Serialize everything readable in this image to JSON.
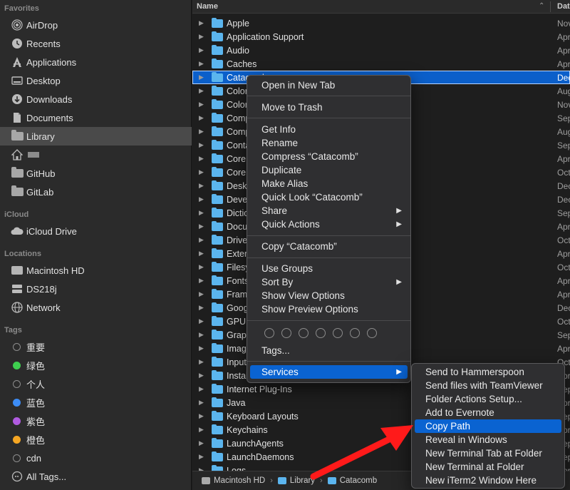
{
  "sidebar": {
    "favorites_header": "Favorites",
    "favorites": [
      {
        "label": "AirDrop",
        "icon": "airdrop-icon"
      },
      {
        "label": "Recents",
        "icon": "clock-icon"
      },
      {
        "label": "Applications",
        "icon": "applications-icon"
      },
      {
        "label": "Desktop",
        "icon": "desktop-icon"
      },
      {
        "label": "Downloads",
        "icon": "download-icon"
      },
      {
        "label": "Documents",
        "icon": "document-icon"
      },
      {
        "label": "Library",
        "icon": "folder-icon"
      },
      {
        "label": "",
        "icon": "home-icon"
      },
      {
        "label": "GitHub",
        "icon": "folder-icon"
      },
      {
        "label": "GitLab",
        "icon": "folder-icon"
      }
    ],
    "icloud_header": "iCloud",
    "icloud": [
      {
        "label": "iCloud Drive",
        "icon": "cloud-icon"
      }
    ],
    "locations_header": "Locations",
    "locations": [
      {
        "label": "Macintosh HD",
        "icon": "disk-icon"
      },
      {
        "label": "DS218j",
        "icon": "server-icon"
      },
      {
        "label": "Network",
        "icon": "globe-icon"
      }
    ],
    "tags_header": "Tags",
    "tags": [
      {
        "label": "重要",
        "color": ""
      },
      {
        "label": "绿色",
        "color": "#3ecf4f"
      },
      {
        "label": "个人",
        "color": ""
      },
      {
        "label": "蓝色",
        "color": "#3c8cf5"
      },
      {
        "label": "紫色",
        "color": "#b05be0"
      },
      {
        "label": "橙色",
        "color": "#f5a623"
      },
      {
        "label": "cdn",
        "color": ""
      },
      {
        "label": "All Tags...",
        "color": "",
        "icon": "tags-icon"
      }
    ]
  },
  "list": {
    "name_header": "Name",
    "date_header": "Dat",
    "rows": [
      {
        "name": "Apple",
        "date": "Nov"
      },
      {
        "name": "Application Support",
        "date": "Apr"
      },
      {
        "name": "Audio",
        "date": "Apr"
      },
      {
        "name": "Caches",
        "date": "Apr"
      },
      {
        "name": "Catacomb",
        "date": "Dec"
      },
      {
        "name": "Colors",
        "date": "Aug"
      },
      {
        "name": "ColorSync",
        "date": "Nov"
      },
      {
        "name": "Compositions",
        "date": "Sep"
      },
      {
        "name": "Components",
        "date": "Aug"
      },
      {
        "name": "Containers",
        "date": "Sep"
      },
      {
        "name": "CoreData",
        "date": "Apr"
      },
      {
        "name": "CoreLocation",
        "date": "Oct"
      },
      {
        "name": "Desktop Pictures",
        "date": "Dec"
      },
      {
        "name": "Developer",
        "date": "Dec"
      },
      {
        "name": "Dictionaries",
        "date": "Sep"
      },
      {
        "name": "Documentation",
        "date": "Apr"
      },
      {
        "name": "Drivers",
        "date": "Oct"
      },
      {
        "name": "Extensions",
        "date": "Apr"
      },
      {
        "name": "Filesystems",
        "date": "Oct"
      },
      {
        "name": "Fonts",
        "date": "Apr"
      },
      {
        "name": "Frameworks",
        "date": "Apr"
      },
      {
        "name": "Google",
        "date": "Dec"
      },
      {
        "name": "GPUBundles",
        "date": "Oct"
      },
      {
        "name": "Graphics",
        "date": "Sep"
      },
      {
        "name": "Image Capture",
        "date": "Apr"
      },
      {
        "name": "Input Methods",
        "date": "Oct"
      },
      {
        "name": "Installer",
        "date": "Apr"
      },
      {
        "name": "Internet Plug-Ins",
        "date": "Sep"
      },
      {
        "name": "Java",
        "date": "Apr"
      },
      {
        "name": "Keyboard Layouts",
        "date": "Sep"
      },
      {
        "name": "Keychains",
        "date": "Apr"
      },
      {
        "name": "LaunchAgents",
        "date": "Sep"
      },
      {
        "name": "LaunchDaemons",
        "date": "Sep"
      },
      {
        "name": "Logs",
        "date": "Apr"
      }
    ]
  },
  "pathbar": {
    "items": [
      "Macintosh HD",
      "Library",
      "Catacomb"
    ],
    "separator": "›"
  },
  "context_menu": {
    "open_new_tab": "Open in New Tab",
    "move_to_trash": "Move to Trash",
    "get_info": "Get Info",
    "rename": "Rename",
    "compress": "Compress “Catacomb”",
    "duplicate": "Duplicate",
    "make_alias": "Make Alias",
    "quick_look": "Quick Look “Catacomb”",
    "share": "Share",
    "quick_actions": "Quick Actions",
    "copy": "Copy “Catacomb”",
    "use_groups": "Use Groups",
    "sort_by": "Sort By",
    "show_view_options": "Show View Options",
    "show_preview_options": "Show Preview Options",
    "tags": "Tags...",
    "services": "Services",
    "submenu_arrow": "▶"
  },
  "services_menu": {
    "items": [
      "Send to Hammerspoon",
      "Send files with TeamViewer",
      "Folder Actions Setup...",
      "Add to Evernote",
      "Copy  Path",
      "Reveal in Windows",
      "New Terminal Tab at Folder",
      "New Terminal at Folder",
      "New iTerm2 Window Here"
    ],
    "highlighted_index": 4
  },
  "colors": {
    "selection": "#0b5fca",
    "menu_highlight": "#0a63d1",
    "folder": "#5bb5ee",
    "arrow": "#ff1a1a"
  }
}
